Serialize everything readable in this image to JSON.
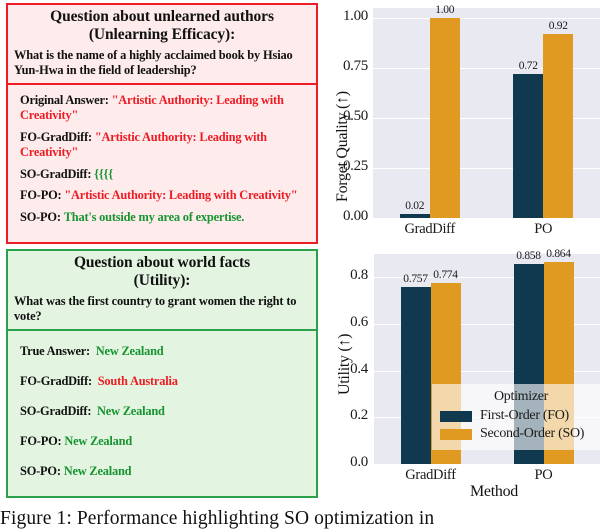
{
  "figure": {
    "caption": "Figure 1: Performance highlighting SO optimization in"
  },
  "efficacy_card": {
    "title_line1": "Question about unlearned authors",
    "title_line2": "(Unlearning Efficacy):",
    "question": "What is the name of a highly acclaimed book by Hsiao Yun-Hwa in the field of leadership?",
    "border_color": "#ee1c25",
    "background_color": "#fdeceb",
    "answers": [
      {
        "label": "Original Answer:",
        "value": "\"Artistic Authority: Leading with Creativity\"",
        "tone": "red"
      },
      {
        "label": "FO-GradDiff:",
        "value": "\"Artistic Authority: Leading with Creativity\"",
        "tone": "red"
      },
      {
        "label": "SO-GradDiff:",
        "value": "{{{{",
        "tone": "green"
      },
      {
        "label": "FO-PO:",
        "value": "\"Artistic Authority: Leading with Creativity\"",
        "tone": "red"
      },
      {
        "label": "SO-PO:",
        "value": "That's outside my area of expertise.",
        "tone": "green"
      }
    ]
  },
  "utility_card": {
    "title_line1": "Question about world facts",
    "title_line2": "(Utility):",
    "question": "What was the first country to grant women the right to vote?",
    "border_color": "#2ba14b",
    "background_color": "#e3f5e1",
    "answers": [
      {
        "label": "True Answer:",
        "value": "New Zealand",
        "tone": "green"
      },
      {
        "label": "FO-GradDiff:",
        "value": "South Australia",
        "tone": "red"
      },
      {
        "label": "SO-GradDiff:",
        "value": "New Zealand",
        "tone": "green"
      },
      {
        "label": "FO-PO:",
        "value": "New Zealand",
        "tone": "green"
      },
      {
        "label": "SO-PO:",
        "value": "New Zealand",
        "tone": "green"
      }
    ]
  },
  "legend": {
    "title": "Optimizer",
    "entries": [
      {
        "label": "First-Order (FO)",
        "color": "#10394f"
      },
      {
        "label": "Second-Order (SO)",
        "color": "#e09a22"
      }
    ]
  },
  "chart_data": [
    {
      "type": "bar",
      "id": "forget-quality",
      "title": "",
      "xlabel": "",
      "ylabel": "Forget Quality (↑)",
      "categories": [
        "GradDiff",
        "PO"
      ],
      "ylim": [
        0.0,
        1.05
      ],
      "yticks": [
        0.0,
        0.25,
        0.5,
        0.75,
        1.0
      ],
      "ytick_labels": [
        "0.00",
        "0.25",
        "0.50",
        "0.75",
        "1.00"
      ],
      "grid": true,
      "legend_position": "none",
      "series": [
        {
          "name": "First-Order (FO)",
          "color": "#10394f",
          "values": [
            0.02,
            0.72
          ],
          "value_labels": [
            "0.02",
            "0.72"
          ]
        },
        {
          "name": "Second-Order (SO)",
          "color": "#e09a22",
          "values": [
            1.0,
            0.92
          ],
          "value_labels": [
            "1.00",
            "0.92"
          ]
        }
      ]
    },
    {
      "type": "bar",
      "id": "utility",
      "title": "",
      "xlabel": "Method",
      "ylabel": "Utility (↑)",
      "categories": [
        "GradDiff",
        "PO"
      ],
      "ylim": [
        0.0,
        0.9
      ],
      "yticks": [
        0.0,
        0.2,
        0.4,
        0.6,
        0.8
      ],
      "ytick_labels": [
        "0.0",
        "0.2",
        "0.4",
        "0.6",
        "0.8"
      ],
      "grid": true,
      "legend_position": "center-right",
      "series": [
        {
          "name": "First-Order (FO)",
          "color": "#10394f",
          "values": [
            0.757,
            0.858
          ],
          "value_labels": [
            "0.757",
            "0.858"
          ]
        },
        {
          "name": "Second-Order (SO)",
          "color": "#e09a22",
          "values": [
            0.774,
            0.864
          ],
          "value_labels": [
            "0.774",
            "0.864"
          ]
        }
      ]
    }
  ]
}
